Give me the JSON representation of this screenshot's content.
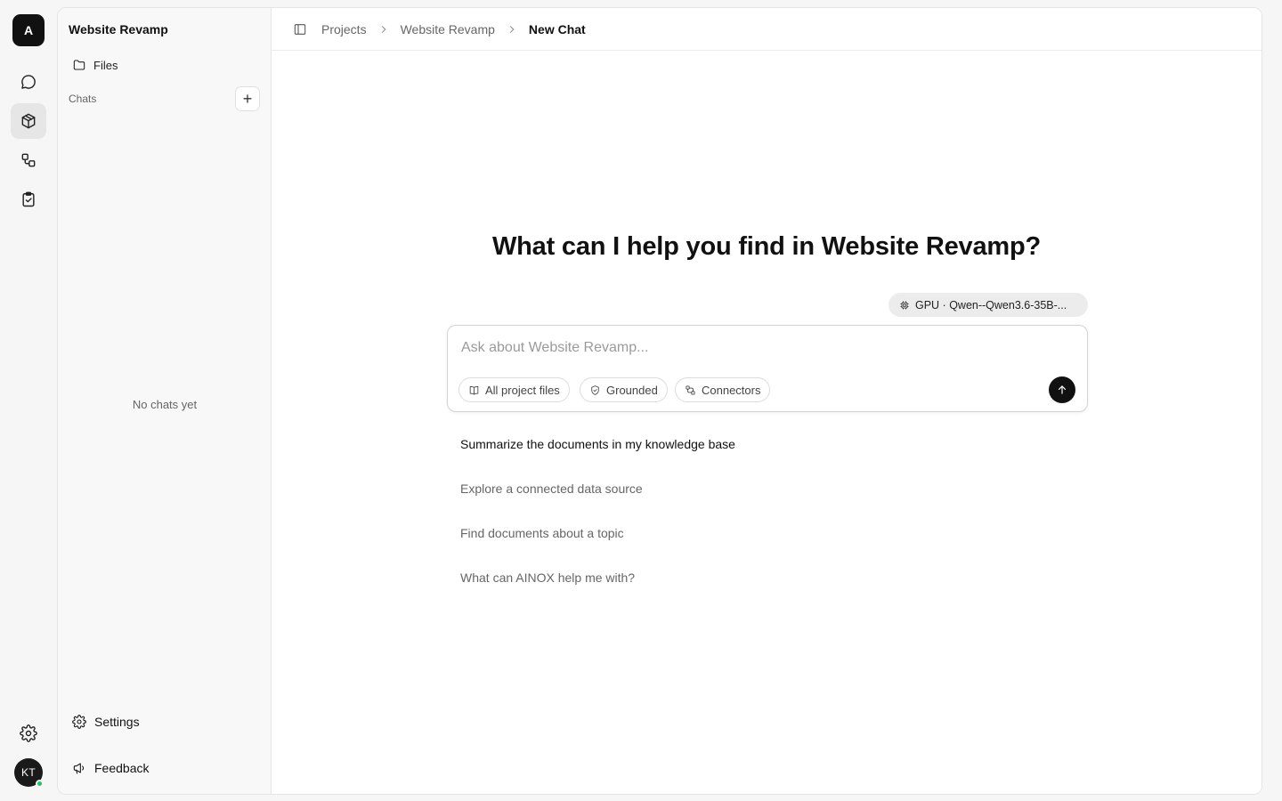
{
  "app": {
    "logo_letter": "A",
    "user_initials": "KT"
  },
  "rail": {
    "items": [
      {
        "icon": "chat-bubble-icon"
      },
      {
        "icon": "cube-icon",
        "active": true
      },
      {
        "icon": "workflow-icon"
      },
      {
        "icon": "clipboard-check-icon"
      }
    ],
    "bottom_icon": "gear-icon"
  },
  "sidebar": {
    "project_title": "Website Revamp",
    "files_label": "Files",
    "chats_label": "Chats",
    "new_chat_symbol": "+",
    "empty_state": "No chats yet",
    "settings_label": "Settings",
    "feedback_label": "Feedback"
  },
  "breadcrumb": {
    "items": [
      "Projects",
      "Website Revamp",
      "New Chat"
    ]
  },
  "main": {
    "headline": "What can I help you find in Website Revamp?",
    "model_label": "GPU · Qwen--Qwen3.6-35B-...",
    "composer": {
      "placeholder": "Ask about Website Revamp...",
      "value": ""
    },
    "chips": [
      {
        "label": "All project files",
        "icon": "book-icon"
      },
      {
        "label": "Grounded",
        "icon": "shield-check-icon"
      },
      {
        "label": "Connectors",
        "icon": "connectors-icon"
      }
    ],
    "suggestions": [
      "Summarize the documents in my knowledge base",
      "Explore a connected data source",
      "Find documents about a topic",
      "What can AINOX help me with?"
    ]
  },
  "colors": {
    "accent": "#111111",
    "presence": "#22c55e",
    "background": "#f6f6f6"
  }
}
